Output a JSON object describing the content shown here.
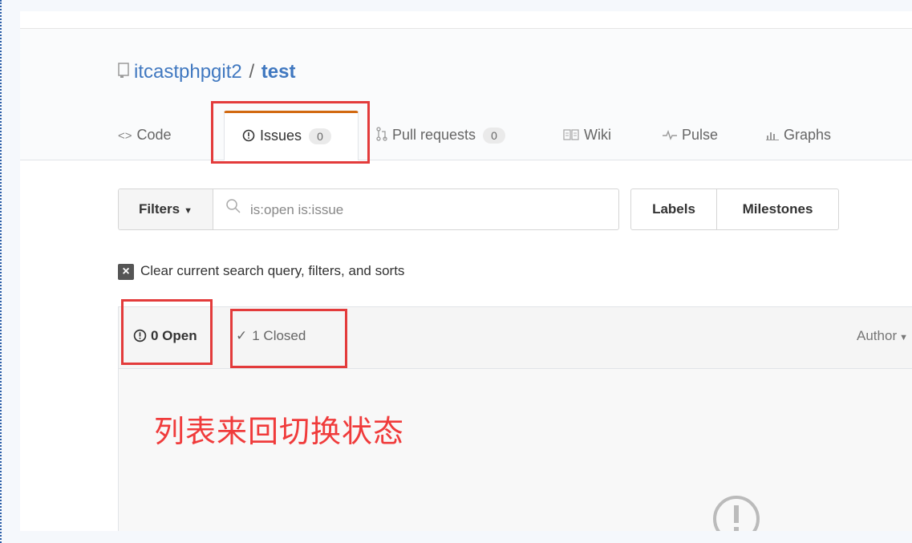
{
  "repo": {
    "owner": "itcastphpgit2",
    "separator": "/",
    "name": "test"
  },
  "tabs": [
    {
      "label": "Code",
      "icon": "code-icon",
      "glyph": "<>"
    },
    {
      "label": "Issues",
      "count": "0",
      "icon": "issue-opened-icon",
      "selected": true
    },
    {
      "label": "Pull requests",
      "count": "0",
      "icon": "git-pull-request-icon"
    },
    {
      "label": "Wiki",
      "icon": "book-icon"
    },
    {
      "label": "Pulse",
      "icon": "pulse-icon"
    },
    {
      "label": "Graphs",
      "icon": "graph-icon"
    }
  ],
  "filters": {
    "label": "Filters",
    "search_value": "is:open is:issue"
  },
  "labels_button": "Labels",
  "milestones_button": "Milestones",
  "clear_query": "Clear current search query, filters, and sorts",
  "list": {
    "open": "0 Open",
    "closed": "1 Closed",
    "author": "Author"
  },
  "annotation": "列表来回切换状态",
  "colors": {
    "accent_tab": "#d26911",
    "link": "#4078c0",
    "highlight": "#e33b3b"
  }
}
